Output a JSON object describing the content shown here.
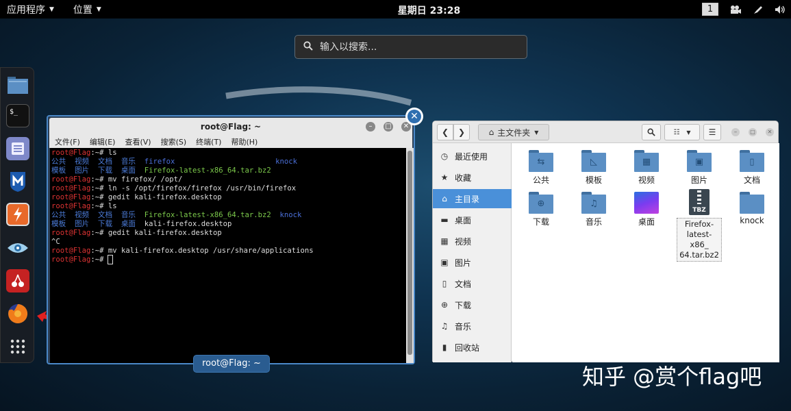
{
  "topbar": {
    "apps_label": "应用程序",
    "places_label": "位置",
    "clock": "星期日 23:28",
    "workspace": "1"
  },
  "search": {
    "placeholder": "输入以搜索..."
  },
  "dock": {
    "items": [
      "files-icon",
      "terminal-icon",
      "text-editor-icon",
      "metasploit-icon",
      "burpsuite-icon",
      "eye-icon",
      "cherrytree-icon",
      "firefox-icon",
      "app-grid-icon"
    ]
  },
  "terminal": {
    "title": "root@Flag: ~",
    "menu": [
      "文件(F)",
      "编辑(E)",
      "查看(V)",
      "搜索(S)",
      "终端(T)",
      "帮助(H)"
    ],
    "prompt_user": "root@Flag",
    "prompt_suffix": ":~# ",
    "lines": [
      {
        "type": "cmd",
        "text": "ls"
      },
      {
        "type": "ls1"
      },
      {
        "type": "ls2"
      },
      {
        "type": "cmd",
        "text": "mv firefox/ /opt/"
      },
      {
        "type": "cmd",
        "text": "ln -s /opt/firefox/firefox /usr/bin/firefox"
      },
      {
        "type": "cmd",
        "text": "gedit kali-firefox.desktop"
      },
      {
        "type": "cmd",
        "text": "ls"
      },
      {
        "type": "ls3"
      },
      {
        "type": "ls4"
      },
      {
        "type": "cmd",
        "text": "gedit kali-firefox.desktop"
      },
      {
        "type": "plain",
        "text": "^C"
      },
      {
        "type": "cmd",
        "text": "mv kali-firefox.desktop /usr/share/applications"
      },
      {
        "type": "cursor"
      }
    ],
    "ls_row1": [
      "公共",
      "视频",
      "文档",
      "音乐"
    ],
    "ls_row1_dir": "firefox",
    "ls_row1_end": "knock",
    "ls_row2": [
      "模板",
      "图片",
      "下载",
      "桌面"
    ],
    "ls_row2_file": "Firefox-latest-x86_64.tar.bz2",
    "ls_row3_file": "Firefox-latest-x86_64.tar.bz2",
    "ls_row3_end": "knock",
    "ls_row4_file": "kali-firefox.desktop",
    "taskbar_label": "root@Flag: ~"
  },
  "filemanager": {
    "location": "主文件夹",
    "sidebar": [
      {
        "icon": "clock-icon",
        "glyph": "◷",
        "label": "最近使用"
      },
      {
        "icon": "star-icon",
        "glyph": "★",
        "label": "收藏"
      },
      {
        "icon": "home-icon",
        "glyph": "⌂",
        "label": "主目录",
        "active": true
      },
      {
        "icon": "desktop-icon",
        "glyph": "▬",
        "label": "桌面"
      },
      {
        "icon": "video-icon",
        "glyph": "▦",
        "label": "视频"
      },
      {
        "icon": "picture-icon",
        "glyph": "▣",
        "label": "图片"
      },
      {
        "icon": "document-icon",
        "glyph": "▯",
        "label": "文档"
      },
      {
        "icon": "download-icon",
        "glyph": "⊕",
        "label": "下载"
      },
      {
        "icon": "music-icon",
        "glyph": "♫",
        "label": "音乐"
      },
      {
        "icon": "trash-icon",
        "glyph": "▮",
        "label": "回收站"
      }
    ],
    "files": [
      {
        "name": "公共",
        "kind": "folder",
        "emblem": "⇆"
      },
      {
        "name": "模板",
        "kind": "folder",
        "emblem": "◺"
      },
      {
        "name": "视频",
        "kind": "folder",
        "emblem": "▦"
      },
      {
        "name": "图片",
        "kind": "folder",
        "emblem": "▣"
      },
      {
        "name": "文档",
        "kind": "folder",
        "emblem": "▯"
      },
      {
        "name": "下载",
        "kind": "folder",
        "emblem": "⊕"
      },
      {
        "name": "音乐",
        "kind": "folder",
        "emblem": "♫"
      },
      {
        "name": "桌面",
        "kind": "desktop",
        "emblem": ""
      },
      {
        "name": "Firefox-latest-x86_64.tar.bz2",
        "kind": "archive",
        "emblem": "TBZ"
      },
      {
        "name": "knock",
        "kind": "folder",
        "emblem": ""
      }
    ],
    "selected_name_lines": [
      "Firefox-",
      "latest-x86_",
      "64.tar.bz2"
    ]
  },
  "watermark": "知乎 @赏个flag吧"
}
